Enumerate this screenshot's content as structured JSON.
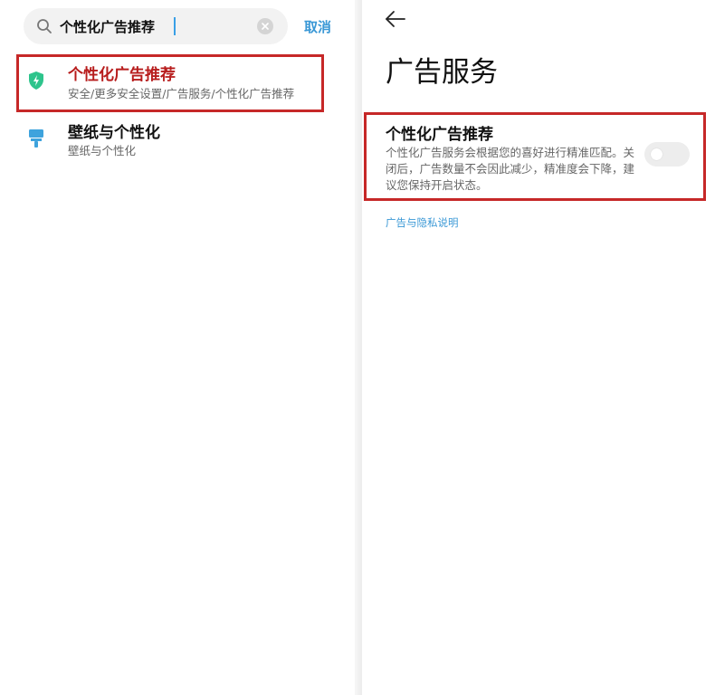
{
  "search": {
    "value": "个性化广告推荐",
    "cancel_label": "取消"
  },
  "results": [
    {
      "title": "个性化广告推荐",
      "path": "安全/更多安全设置/广告服务/个性化广告推荐",
      "icon": "shield-icon",
      "highlighted": true
    },
    {
      "title": "壁纸与个性化",
      "path": "壁纸与个性化",
      "icon": "paint-roller-icon",
      "highlighted": false
    }
  ],
  "ad_service": {
    "title": "广告服务",
    "setting": {
      "title": "个性化广告推荐",
      "description": "个性化广告服务会根据您的喜好进行精准匹配。关闭后，广告数量不会因此减少，精准度会下降，建议您保持开启状态。",
      "enabled": false
    },
    "privacy_link": "广告与隐私说明"
  },
  "colors": {
    "accent": "#3a98d6",
    "highlight": "#c62828",
    "shield": "#2ec48c",
    "roller": "#3ea3dd"
  }
}
